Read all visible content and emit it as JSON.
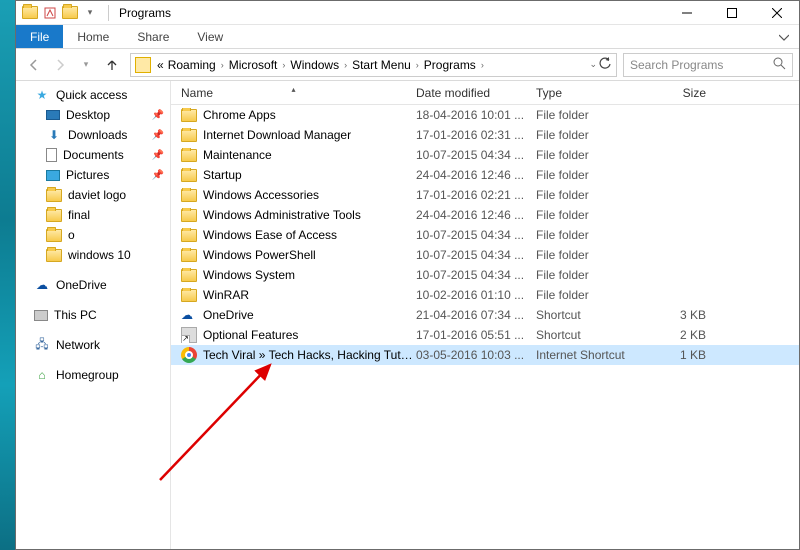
{
  "window": {
    "title": "Programs",
    "tabs": {
      "file": "File",
      "home": "Home",
      "share": "Share",
      "view": "View"
    }
  },
  "breadcrumb": {
    "prefix": "«",
    "items": [
      "Roaming",
      "Microsoft",
      "Windows",
      "Start Menu",
      "Programs"
    ]
  },
  "search": {
    "placeholder": "Search Programs"
  },
  "sidebar": {
    "quick_access": "Quick access",
    "pinned": [
      {
        "label": "Desktop",
        "icon": "desktop"
      },
      {
        "label": "Downloads",
        "icon": "downloads"
      },
      {
        "label": "Documents",
        "icon": "documents"
      },
      {
        "label": "Pictures",
        "icon": "pictures"
      }
    ],
    "recent": [
      {
        "label": "daviet logo"
      },
      {
        "label": "final"
      },
      {
        "label": "o"
      },
      {
        "label": "windows 10"
      }
    ],
    "roots": [
      {
        "label": "OneDrive",
        "icon": "onedrive"
      },
      {
        "label": "This PC",
        "icon": "thispc"
      },
      {
        "label": "Network",
        "icon": "network"
      },
      {
        "label": "Homegroup",
        "icon": "homegroup"
      }
    ]
  },
  "columns": {
    "name": "Name",
    "date": "Date modified",
    "type": "Type",
    "size": "Size"
  },
  "files": [
    {
      "name": "Chrome Apps",
      "date": "18-04-2016 10:01 ...",
      "type": "File folder",
      "size": "",
      "icon": "folder"
    },
    {
      "name": "Internet Download Manager",
      "date": "17-01-2016 02:31 ...",
      "type": "File folder",
      "size": "",
      "icon": "folder"
    },
    {
      "name": "Maintenance",
      "date": "10-07-2015 04:34 ...",
      "type": "File folder",
      "size": "",
      "icon": "folder"
    },
    {
      "name": "Startup",
      "date": "24-04-2016 12:46 ...",
      "type": "File folder",
      "size": "",
      "icon": "folder"
    },
    {
      "name": "Windows Accessories",
      "date": "17-01-2016 02:21 ...",
      "type": "File folder",
      "size": "",
      "icon": "folder"
    },
    {
      "name": "Windows Administrative Tools",
      "date": "24-04-2016 12:46 ...",
      "type": "File folder",
      "size": "",
      "icon": "folder"
    },
    {
      "name": "Windows Ease of Access",
      "date": "10-07-2015 04:34 ...",
      "type": "File folder",
      "size": "",
      "icon": "folder"
    },
    {
      "name": "Windows PowerShell",
      "date": "10-07-2015 04:34 ...",
      "type": "File folder",
      "size": "",
      "icon": "folder"
    },
    {
      "name": "Windows System",
      "date": "10-07-2015 04:34 ...",
      "type": "File folder",
      "size": "",
      "icon": "folder"
    },
    {
      "name": "WinRAR",
      "date": "10-02-2016 01:10 ...",
      "type": "File folder",
      "size": "",
      "icon": "folder"
    },
    {
      "name": "OneDrive",
      "date": "21-04-2016 07:34 ...",
      "type": "Shortcut",
      "size": "3 KB",
      "icon": "onedrive-shortcut"
    },
    {
      "name": "Optional Features",
      "date": "17-01-2016 05:51 ...",
      "type": "Shortcut",
      "size": "2 KB",
      "icon": "shortcut"
    },
    {
      "name": "Tech Viral » Tech Hacks, Hacking Tutoria...",
      "date": "03-05-2016 10:03 ...",
      "type": "Internet Shortcut",
      "size": "1 KB",
      "icon": "chrome",
      "selected": true
    }
  ]
}
